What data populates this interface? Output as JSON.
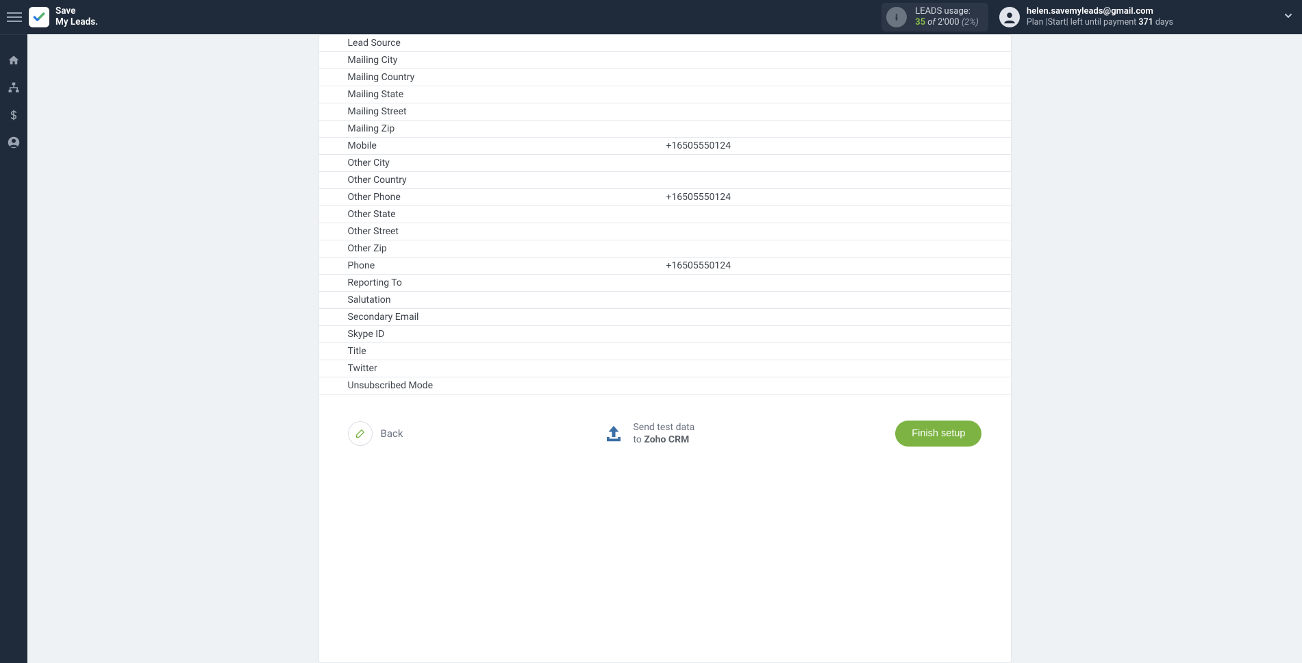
{
  "brand": {
    "line1": "Save",
    "line2": "My Leads."
  },
  "usage": {
    "label": "LEADS usage:",
    "used": "35",
    "of": "of",
    "total": "2'000",
    "pct": "(2%)"
  },
  "account": {
    "email": "helen.savemyleads@gmail.com",
    "plan_prefix": "Plan |Start| left until payment ",
    "days": "371",
    "days_suffix": " days"
  },
  "fields": [
    {
      "label": "Lead Source",
      "value": ""
    },
    {
      "label": "Mailing City",
      "value": ""
    },
    {
      "label": "Mailing Country",
      "value": ""
    },
    {
      "label": "Mailing State",
      "value": ""
    },
    {
      "label": "Mailing Street",
      "value": ""
    },
    {
      "label": "Mailing Zip",
      "value": ""
    },
    {
      "label": "Mobile",
      "value": "+16505550124"
    },
    {
      "label": "Other City",
      "value": ""
    },
    {
      "label": "Other Country",
      "value": ""
    },
    {
      "label": "Other Phone",
      "value": "+16505550124"
    },
    {
      "label": "Other State",
      "value": ""
    },
    {
      "label": "Other Street",
      "value": ""
    },
    {
      "label": "Other Zip",
      "value": ""
    },
    {
      "label": "Phone",
      "value": "+16505550124"
    },
    {
      "label": "Reporting To",
      "value": ""
    },
    {
      "label": "Salutation",
      "value": ""
    },
    {
      "label": "Secondary Email",
      "value": ""
    },
    {
      "label": "Skype ID",
      "value": ""
    },
    {
      "label": "Title",
      "value": ""
    },
    {
      "label": "Twitter",
      "value": ""
    },
    {
      "label": "Unsubscribed Mode",
      "value": ""
    }
  ],
  "footer": {
    "back": "Back",
    "send_line1": "Send test data",
    "send_line2_prefix": "to ",
    "send_target": "Zoho CRM",
    "finish": "Finish setup"
  },
  "colors": {
    "accent_green": "#7cb342",
    "upload_blue": "#3b6ea5"
  }
}
